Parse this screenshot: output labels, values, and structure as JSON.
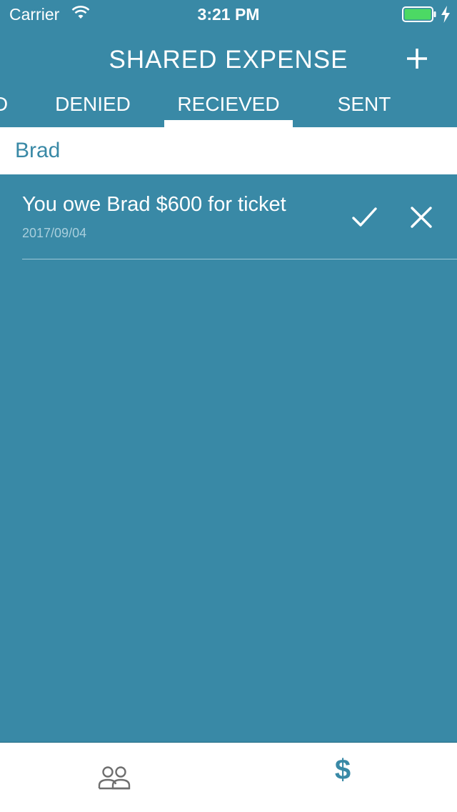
{
  "status_bar": {
    "carrier": "Carrier",
    "time": "3:21 PM",
    "battery_color": "#4cd964"
  },
  "nav": {
    "title": "SHARED EXPENSE",
    "add_icon": "plus-icon"
  },
  "tabs": [
    {
      "label": "D",
      "selected": false
    },
    {
      "label": "DENIED",
      "selected": false
    },
    {
      "label": "RECIEVED",
      "selected": true
    },
    {
      "label": "SENT",
      "selected": false
    }
  ],
  "section": {
    "title": "Brad"
  },
  "expenses": [
    {
      "text": "You owe Brad $600 for ticket",
      "date": "2017/09/04",
      "accept_icon": "checkmark-icon",
      "deny_icon": "close-icon"
    }
  ],
  "tab_bar": {
    "items": [
      {
        "icon": "people-icon",
        "selected": false
      },
      {
        "icon": "dollar-icon",
        "glyph": "$",
        "selected": true
      }
    ]
  },
  "colors": {
    "accent": "#3989a6",
    "background": "#3989a6",
    "white": "#ffffff",
    "date_text": "#a9cfdd"
  }
}
